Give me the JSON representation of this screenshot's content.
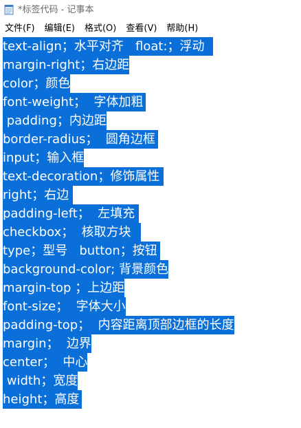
{
  "window": {
    "title": "*标签代码 - 记事本",
    "icon": "notepad-icon"
  },
  "menu": [
    "文件(F)",
    "编辑(E)",
    "格式(O)",
    "查看(V)",
    "帮助(H)"
  ],
  "editor": {
    "selection_color": "#0a6fd8",
    "lines": [
      "text-align；水平对齐   float:；浮动",
      "margin-right；右边距",
      "color；颜色",
      "font-weight；  字体加粗",
      " padding；内边距",
      "border-radius；  圆角边框",
      "input；输入框",
      "text-decoration；修饰属性",
      "right；右边",
      "padding-left；  左填充",
      "checkbox；  核取方块",
      "type；型号   button；按钮",
      "background-color; 背景颜色",
      "margin-top ；上边距",
      "font-size；  字体大小",
      "padding-top；  内容距离顶部边框的长度",
      "margin；  边界",
      "center；  中心",
      " width；宽度",
      "height；高度"
    ]
  }
}
